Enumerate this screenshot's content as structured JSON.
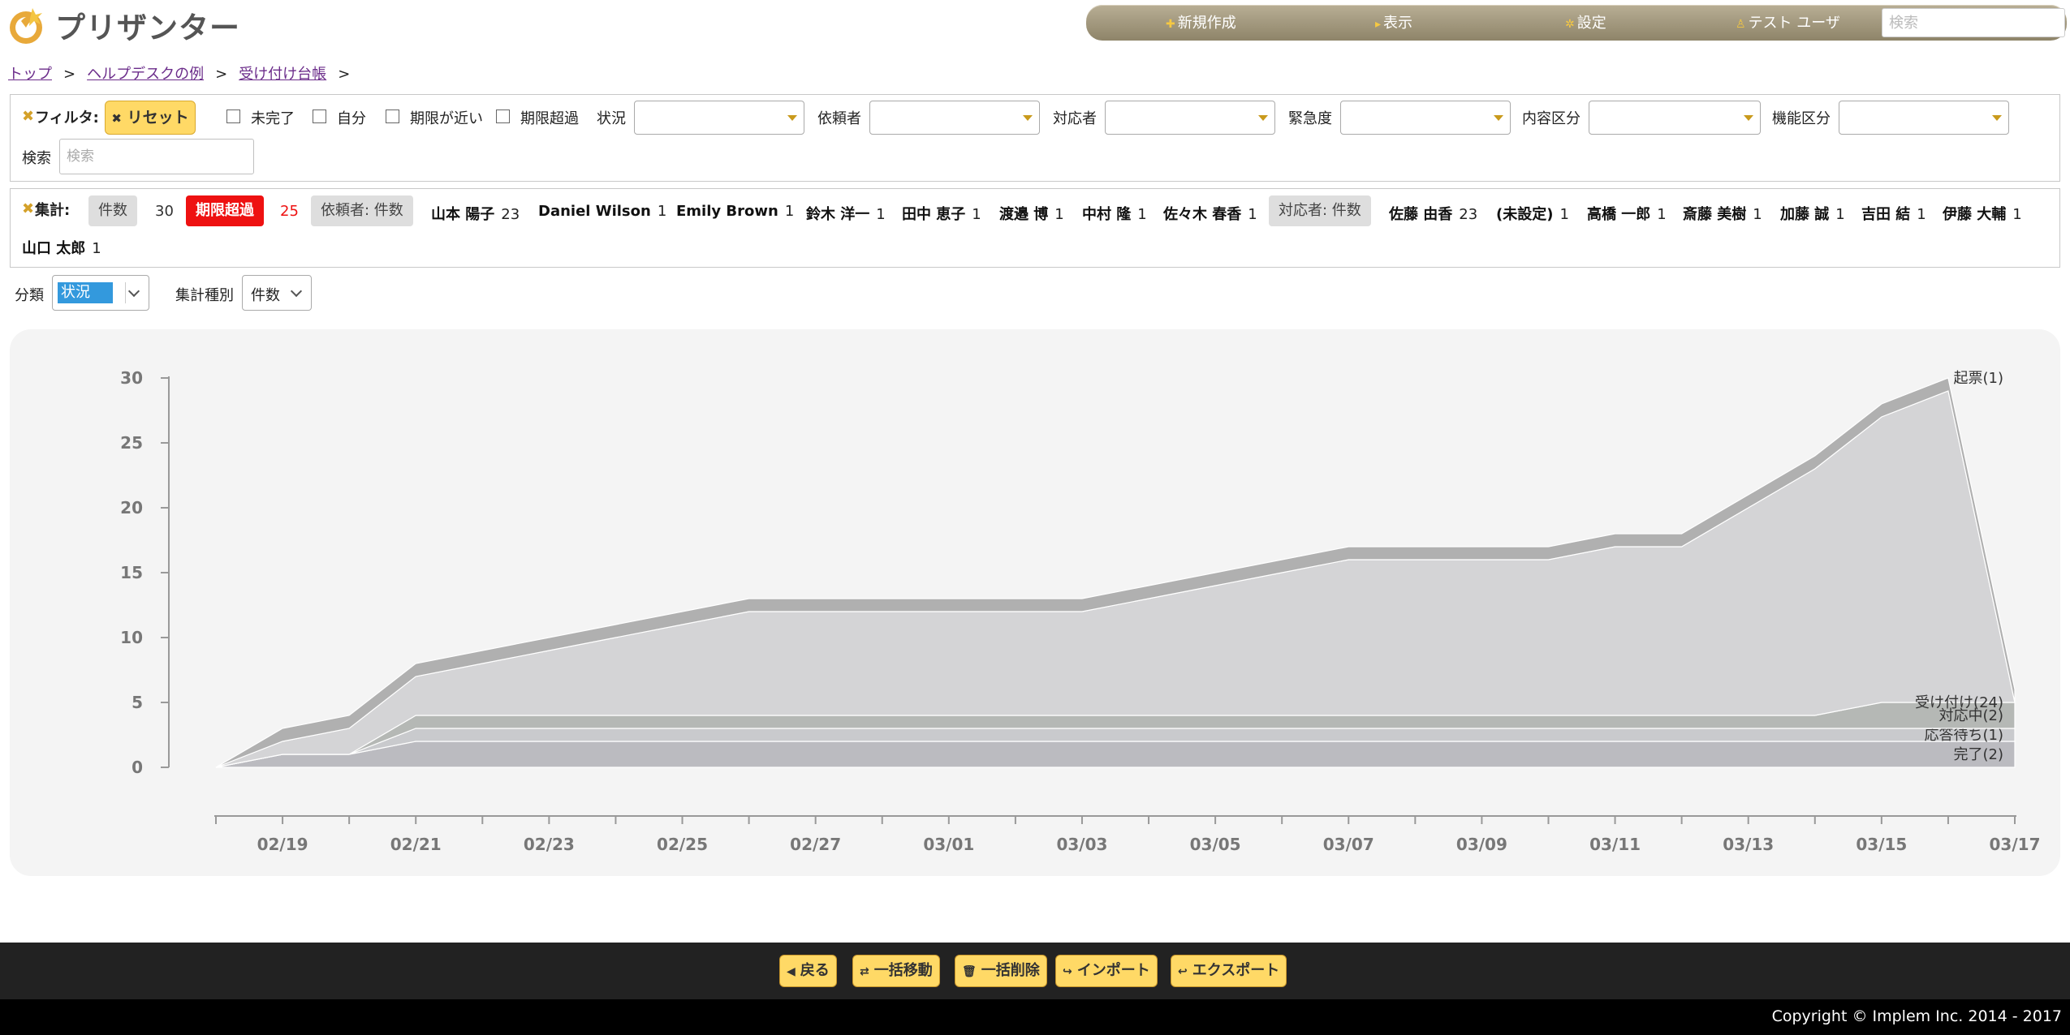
{
  "app": {
    "title": "プリザンター"
  },
  "menu": {
    "new_label": "新規作成",
    "view_label": "表示",
    "settings_label": "設定",
    "user_label": "テスト ユーザ",
    "search_placeholder": "検索"
  },
  "breadcrumb": {
    "items": [
      "トップ",
      "ヘルプデスクの例",
      "受け付け台帳"
    ],
    "separator": ">"
  },
  "filter": {
    "title": "フィルタ:",
    "reset_label": "リセット",
    "checkboxes": [
      "未完了",
      "自分",
      "期限が近い",
      "期限超過"
    ],
    "selects": [
      "状況",
      "依頼者",
      "対応者",
      "緊急度",
      "内容区分",
      "機能区分"
    ],
    "search_label": "検索",
    "search_placeholder": "検索"
  },
  "summary": {
    "title": "集計:",
    "count_label": "件数",
    "count_value": "30",
    "overdue_label": "期限超過",
    "overdue_value": "25",
    "requester_label": "依頼者: 件数",
    "requesters": [
      {
        "name": "山本 陽子",
        "count": "23"
      },
      {
        "name": "Daniel Wilson",
        "count": "1"
      },
      {
        "name": "Emily Brown",
        "count": "1"
      },
      {
        "name": "鈴木 洋一",
        "count": "1"
      },
      {
        "name": "田中 恵子",
        "count": "1"
      },
      {
        "name": "渡邉 博",
        "count": "1"
      },
      {
        "name": "中村 隆",
        "count": "1"
      },
      {
        "name": "佐々木 春香",
        "count": "1"
      }
    ],
    "assignee_label": "対応者: 件数",
    "assignees": [
      {
        "name": "佐藤 由香",
        "count": "23"
      },
      {
        "name": "(未設定)",
        "count": "1"
      },
      {
        "name": "高橋 一郎",
        "count": "1"
      },
      {
        "name": "斎藤 美樹",
        "count": "1"
      },
      {
        "name": "加藤 誠",
        "count": "1"
      },
      {
        "name": "吉田 結",
        "count": "1"
      },
      {
        "name": "伊藤 大輔",
        "count": "1"
      },
      {
        "name": "山口 太郎",
        "count": "1"
      }
    ]
  },
  "options": {
    "classify_label": "分類",
    "classify_value": "状況",
    "aggregate_label": "集計種別",
    "aggregate_value": "件数"
  },
  "chart_data": {
    "type": "area",
    "stacked": true,
    "x": [
      "02/18",
      "02/19",
      "02/20",
      "02/21",
      "02/22",
      "02/23",
      "02/24",
      "02/25",
      "02/26",
      "02/27",
      "02/28",
      "03/01",
      "03/02",
      "03/03",
      "03/04",
      "03/05",
      "03/06",
      "03/07",
      "03/08",
      "03/09",
      "03/10",
      "03/11",
      "03/12",
      "03/13",
      "03/14",
      "03/15",
      "03/16",
      "03/17"
    ],
    "x_tick_labels": [
      "02/19",
      "02/21",
      "02/23",
      "02/25",
      "02/27",
      "03/01",
      "03/03",
      "03/05",
      "03/07",
      "03/09",
      "03/11",
      "03/13",
      "03/15",
      "03/17"
    ],
    "ylim": [
      0,
      30
    ],
    "y_ticks": [
      "0",
      "5",
      "10",
      "15",
      "20",
      "25",
      "30"
    ],
    "grid": false,
    "colors": {
      "完了": "#bbbbc0",
      "応答待ち": "#c9cacd",
      "対応中": "#b5b8b5",
      "受け付け": "#d4d4d6",
      "起票": "#b0b0b0"
    },
    "series": [
      {
        "name": "完了(2)",
        "values": [
          0,
          1,
          1,
          2,
          2,
          2,
          2,
          2,
          2,
          2,
          2,
          2,
          2,
          2,
          2,
          2,
          2,
          2,
          2,
          2,
          2,
          2,
          2,
          2,
          2,
          2,
          2,
          2
        ]
      },
      {
        "name": "応答待ち(1)",
        "values": [
          0,
          0,
          0,
          1,
          1,
          1,
          1,
          1,
          1,
          1,
          1,
          1,
          1,
          1,
          1,
          1,
          1,
          1,
          1,
          1,
          1,
          1,
          1,
          1,
          1,
          1,
          1,
          1
        ]
      },
      {
        "name": "対応中(2)",
        "values": [
          0,
          0,
          0,
          1,
          1,
          1,
          1,
          1,
          1,
          1,
          1,
          1,
          1,
          1,
          1,
          1,
          1,
          1,
          1,
          1,
          1,
          1,
          1,
          1,
          1,
          2,
          2,
          2
        ]
      },
      {
        "name": "受け付け(24)",
        "values": [
          0,
          1,
          2,
          3,
          4,
          5,
          6,
          7,
          8,
          8,
          8,
          8,
          8,
          8,
          9,
          10,
          11,
          12,
          12,
          12,
          12,
          13,
          13,
          16,
          19,
          22,
          24
        ]
      },
      {
        "name": "起票(1)",
        "values": [
          0,
          1,
          1,
          1,
          1,
          1,
          1,
          1,
          1,
          1,
          1,
          1,
          1,
          1,
          1,
          1,
          1,
          1,
          1,
          1,
          1,
          1,
          1,
          1,
          1,
          1,
          1,
          1
        ]
      }
    ]
  },
  "footer": {
    "back_label": "戻る",
    "bulk_move_label": "一括移動",
    "bulk_delete_label": "一括削除",
    "import_label": "インポート",
    "export_label": "エクスポート",
    "copyright": "Copyright © Implem Inc. 2014 - 2017"
  }
}
